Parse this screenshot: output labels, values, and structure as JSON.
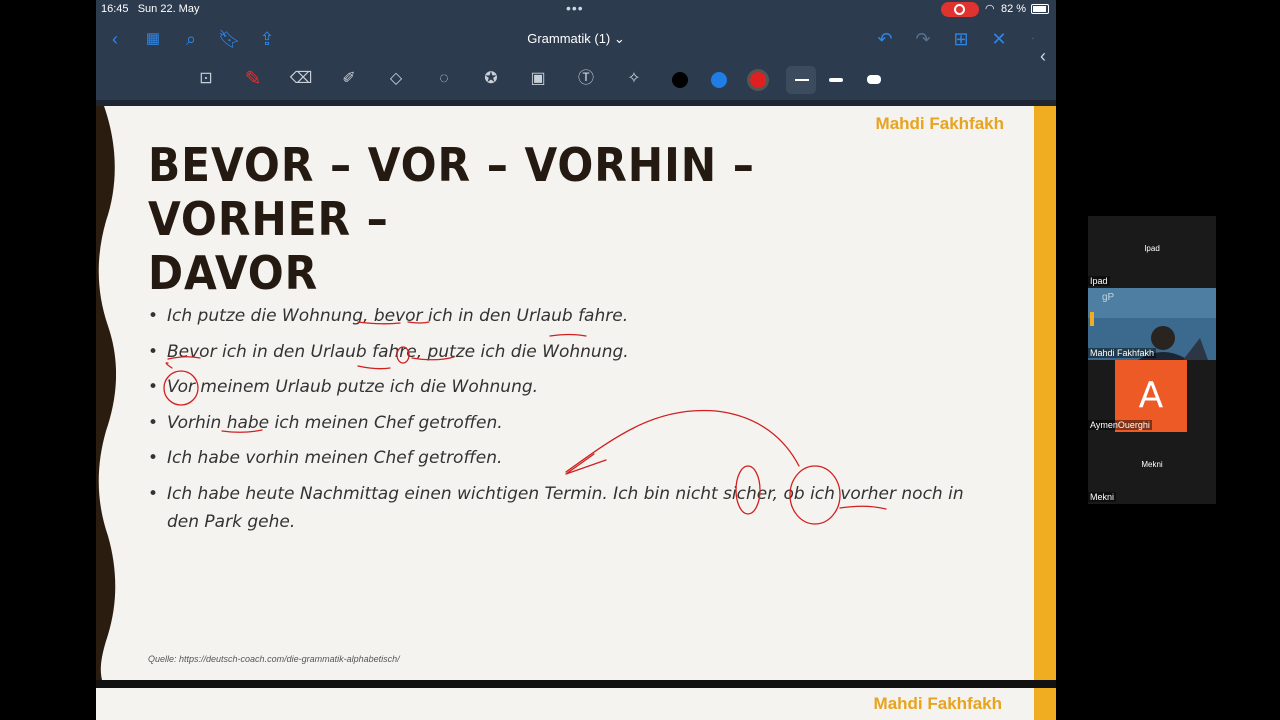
{
  "status": {
    "time": "16:45",
    "date": "Sun 22. May",
    "battery": "82 %"
  },
  "document": {
    "title": "Grammatik (1) ⌄"
  },
  "slide": {
    "author": "Mahdi Fakhfakh",
    "title_line1": "BEVOR – VOR – VORHIN – VORHER –",
    "title_line2": "DAVOR",
    "bullets": [
      "Ich putze die Wohnung, bevor ich in den Urlaub fahre.",
      "Bevor ich in den Urlaub fahre, putze ich die Wohnung.",
      "Vor meinem Urlaub putze ich die Wohnung.",
      "Vorhin habe ich meinen Chef getroffen.",
      "Ich habe vorhin meinen Chef getroffen.",
      "Ich habe heute Nachmittag einen wichtigen Termin. Ich bin nicht sicher, ob ich vorher noch in den Park gehe."
    ],
    "source": "Quelle: https://deutsch-coach.com/die-grammatik-alphabetisch/"
  },
  "next_slide": {
    "author": "Mahdi Fakhfakh"
  },
  "participants": [
    {
      "center_name": "Ipad",
      "label": "Ipad"
    },
    {
      "label": "Mahdi Fakhfakh"
    },
    {
      "avatar_letter": "A",
      "label": "AymenOuerghi"
    },
    {
      "center_name": "Mekni",
      "label": "Mekni"
    }
  ],
  "colors": {
    "accent_blue": "#2f86e6",
    "ink_red": "#d0201f",
    "author_orange": "#e8a31f",
    "strip": "#f0ad22"
  },
  "icons": [
    "back-chevron-icon",
    "grid-icon",
    "search-icon",
    "bookmark-icon",
    "share-icon",
    "undo-icon",
    "redo-icon",
    "add-page-icon",
    "close-icon",
    "lasso-icon",
    "pen-icon",
    "eraser-icon",
    "highlighter-icon",
    "shapes-icon",
    "select-icon",
    "sticker-icon",
    "image-icon",
    "text-icon",
    "laser-icon"
  ]
}
